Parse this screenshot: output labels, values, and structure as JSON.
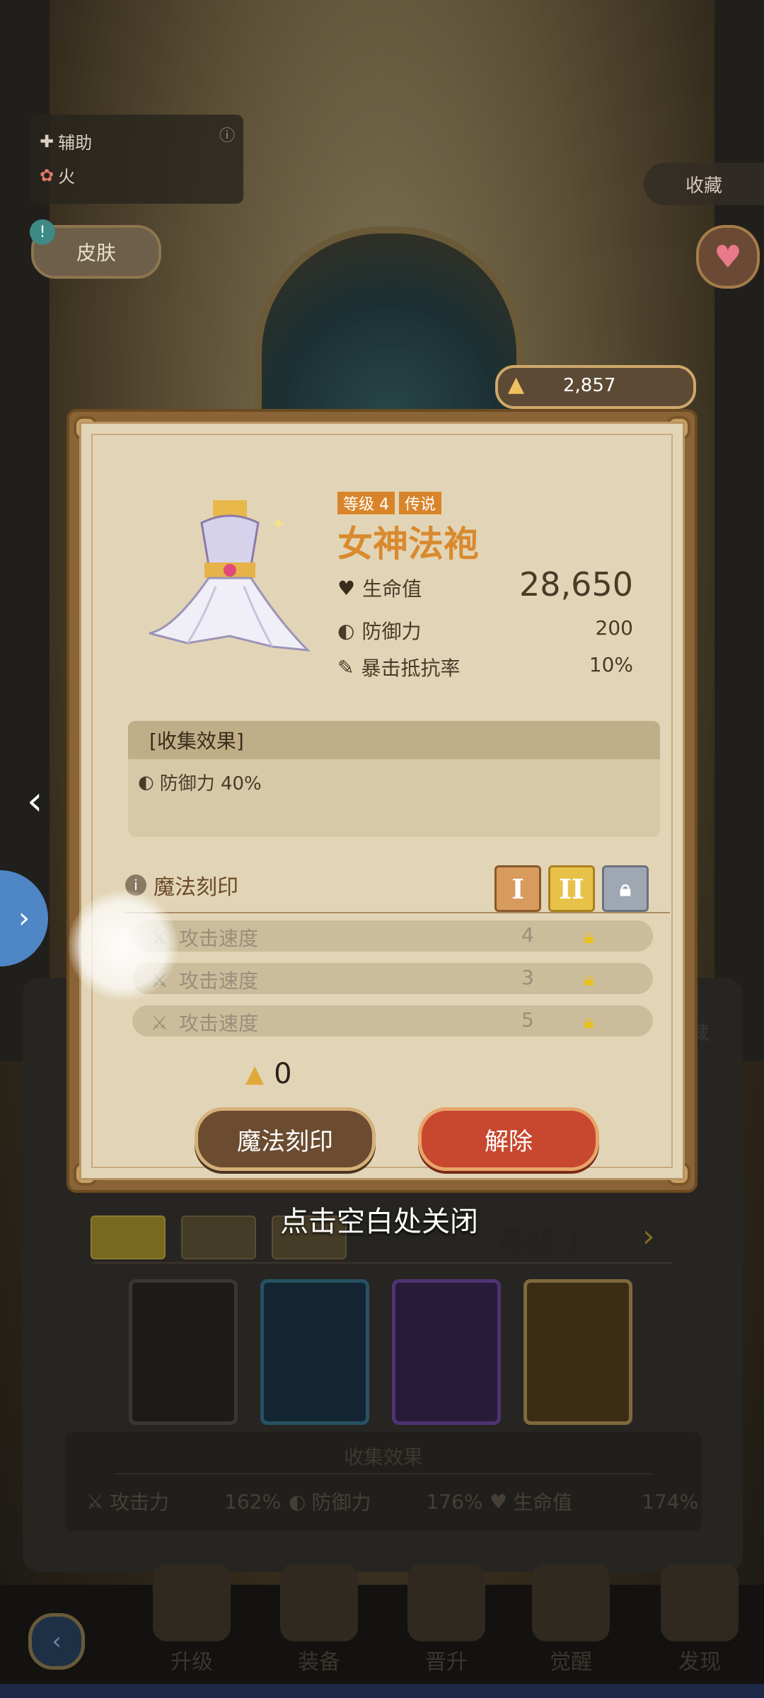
{
  "hero_info": {
    "role": "辅助",
    "element": "火"
  },
  "skin_button": "皮肤",
  "collect_button": "收藏",
  "currency": {
    "amount": "2,857"
  },
  "modal": {
    "level_tag": "等级 4",
    "rarity_tag": "传说",
    "item_name": "女神法袍",
    "stats": [
      {
        "label": "生命值",
        "value": "28,650",
        "icon": "heart-icon"
      },
      {
        "label": "防御力",
        "value": "200",
        "icon": "shield-icon"
      },
      {
        "label": "暴击抵抗率",
        "value": "10%",
        "icon": "feather-icon"
      }
    ],
    "collection_title": "[收集效果]",
    "collection_effect": "防御力 40%",
    "engrave_title": "魔法刻印",
    "tiers": [
      "I",
      "II"
    ],
    "engrave_slots": [
      {
        "name": "攻击速度",
        "value": "4"
      },
      {
        "name": "攻击速度",
        "value": "3"
      },
      {
        "name": "攻击速度",
        "value": "5"
      }
    ],
    "cost": "0",
    "engrave_button": "魔法刻印",
    "release_button": "解除"
  },
  "close_hint": "点击空白处关闭",
  "lower": {
    "grade_label": "等级",
    "grade_numeral": "I",
    "collection_title": "收集效果",
    "effects": [
      {
        "label": "攻击力",
        "value": "162%"
      },
      {
        "label": "防御力",
        "value": "176%"
      },
      {
        "label": "生命值",
        "value": "174%"
      }
    ],
    "side_label": "藏"
  },
  "bottom_nav": [
    "升级",
    "装备",
    "晋升",
    "觉醒",
    "发现"
  ],
  "colors": {
    "accent_orange": "#d98a2e",
    "button_red": "#c7482e",
    "tier_gold": "#e8c248"
  }
}
